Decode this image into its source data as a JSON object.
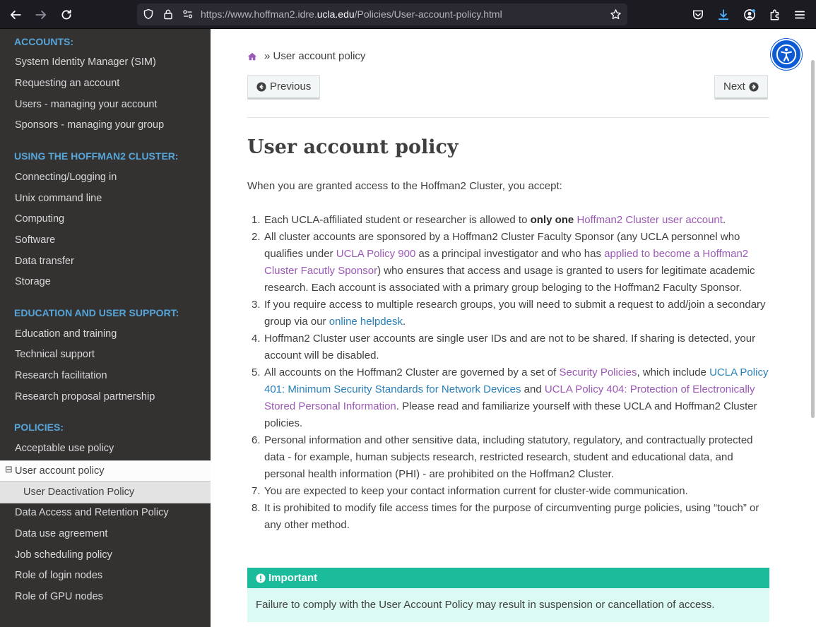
{
  "browser": {
    "url_prefix": "https://www.hoffman2.idre.",
    "url_domain": "ucla.edu",
    "url_path": "/Policies/User-account-policy.html"
  },
  "sidebar": {
    "sections": [
      {
        "caption": "ACCOUNTS:",
        "items": [
          "System Identity Manager (SIM)",
          "Requesting an account",
          "Users - managing your account",
          "Sponsors - managing your group"
        ]
      },
      {
        "caption": "USING THE HOFFMAN2 CLUSTER:",
        "items": [
          "Connecting/Logging in",
          "Unix command line",
          "Computing",
          "Software",
          "Data transfer",
          "Storage"
        ]
      },
      {
        "caption": "EDUCATION AND USER SUPPORT:",
        "items": [
          "Education and training",
          "Technical support",
          "Research facilitation",
          "Research proposal partnership"
        ]
      },
      {
        "caption": "POLICIES:",
        "items": [
          "Acceptable use policy"
        ]
      }
    ],
    "current": "User account policy",
    "current_toggle": "⊟",
    "sub_current": "User Deactivation Policy",
    "after": [
      "Data Access and Retention Policy",
      "Data use agreement",
      "Job scheduling policy",
      "Role of login nodes",
      "Role of GPU nodes"
    ]
  },
  "content": {
    "breadcrumb": "» User account policy",
    "prev_label": "Previous",
    "next_label": "Next",
    "title": "User account policy",
    "intro": "When you are granted access to the Hoffman2 Cluster, you accept:",
    "items": {
      "i1": {
        "num": "1.",
        "a": "Each UCLA-affiliated student or researcher is allowed to ",
        "b": "only one",
        "c": " ",
        "link": "Hoffman2 Cluster user account",
        "d": "."
      },
      "i2": {
        "num": "2.",
        "a": "All cluster accounts are sponsored by a Hoffman2 Cluster Faculty Sponsor (any UCLA personnel who qualifies under ",
        "link1": "UCLA Policy 900",
        "b": " as a principal investigator and who has ",
        "link2": "applied to become a Hoffman2 Cluster Facutly Sponsor",
        "c": ") who ensures that access and usage is granted to users for legitimate academic research. Each account is associated with a primary group beloging to the Hoffman2 Faculty Sponsor."
      },
      "i3": {
        "num": "3.",
        "a": "If you require access to multiple research groups, you will need to submit a request to add/join a secondary group via our ",
        "link": "online helpdesk",
        "b": "."
      },
      "i4": {
        "num": "4.",
        "text": "Hoffman2 Cluster user accounts are single user IDs and are not to be shared. If sharing is detected, your account will be disabled."
      },
      "i5": {
        "num": "5.",
        "a": "All accounts on the Hoffman2 Cluster are governed by a set of ",
        "link1": "Security Policies",
        "b": ", which include ",
        "link2": "UCLA Policy 401: Minimum Security Standards for Network Devices",
        "c": " and ",
        "link3": "UCLA Policy 404: Protection of Electronically Stored Personal Information",
        "d": ". Please read and familiarize yourself with these UCLA and Hoffman2 Cluster policies."
      },
      "i6": {
        "num": "6.",
        "text": "Personal information and other sensitive data, including statutory, regulatory, and contractually protected data - for example, human subjects research, restricted research, student and educational data, and personal health information (PHI) - are prohibited on the Hoffman2 Cluster."
      },
      "i7": {
        "num": "7.",
        "text": "You are expected to keep your contact information current for cluster-wide communication."
      },
      "i8": {
        "num": "8.",
        "text": "It is prohibited to modify file access times for the purpose of circumventing purge policies, using “touch” or any other method."
      }
    },
    "admonition_title": "Important",
    "admonition_body": "Failure to comply with the User Account Policy may result in suspension or cancellation of access."
  },
  "colors": {
    "link": "#2980b9",
    "visited": "#9b59b6",
    "sidebar_bg": "#343131",
    "caption": "#55a5d9",
    "important": "#1abc9c"
  },
  "icons": [
    "back-icon",
    "forward-icon",
    "reload-icon",
    "shield-icon",
    "lock-icon",
    "permissions-icon",
    "bookmark-star-icon",
    "pocket-icon",
    "download-icon",
    "account-icon",
    "extensions-icon",
    "menu-icon",
    "home-icon",
    "arrow-left-circle-icon",
    "arrow-right-circle-icon",
    "exclamation-circle-icon",
    "accessibility-icon"
  ]
}
